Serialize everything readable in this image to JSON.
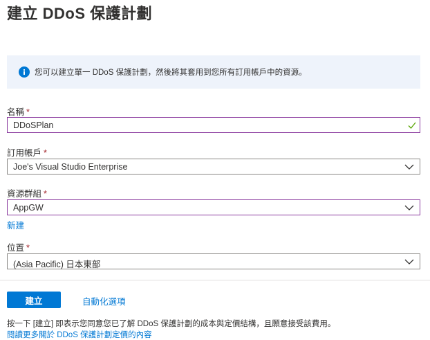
{
  "page": {
    "title": "建立 DDoS 保護計劃"
  },
  "info": {
    "text": "您可以建立單一 DDoS 保護計劃，然後將其套用到您所有訂用帳戶中的資源。"
  },
  "form": {
    "name": {
      "label": "名稱",
      "required": "*",
      "value": "DDoSPlan"
    },
    "subscription": {
      "label": "訂用帳戶",
      "required": "*",
      "value": "Joe's Visual Studio Enterprise"
    },
    "resource_group": {
      "label": "資源群組",
      "required": "*",
      "value": "AppGW",
      "new_link": "新建"
    },
    "location": {
      "label": "位置",
      "required": "*",
      "value": "(Asia Pacific) 日本東部"
    }
  },
  "footer": {
    "create_button": "建立",
    "automation_link": "自動化選項",
    "terms_text": "按一下 [建立] 即表示您同意您已了解 DDoS 保護計劃的成本與定價結構，且願意接受該費用。",
    "learn_more_link": "閱讀更多關於 DDoS 保護計劃定價的內容"
  },
  "colors": {
    "accent": "#0078d4",
    "focus_border": "#8a3a9e",
    "required": "#a4262c",
    "valid_check": "#57a300",
    "info_bg": "#eef3fb"
  },
  "icons": [
    "info-icon",
    "checkmark-icon",
    "chevron-down-icon"
  ]
}
